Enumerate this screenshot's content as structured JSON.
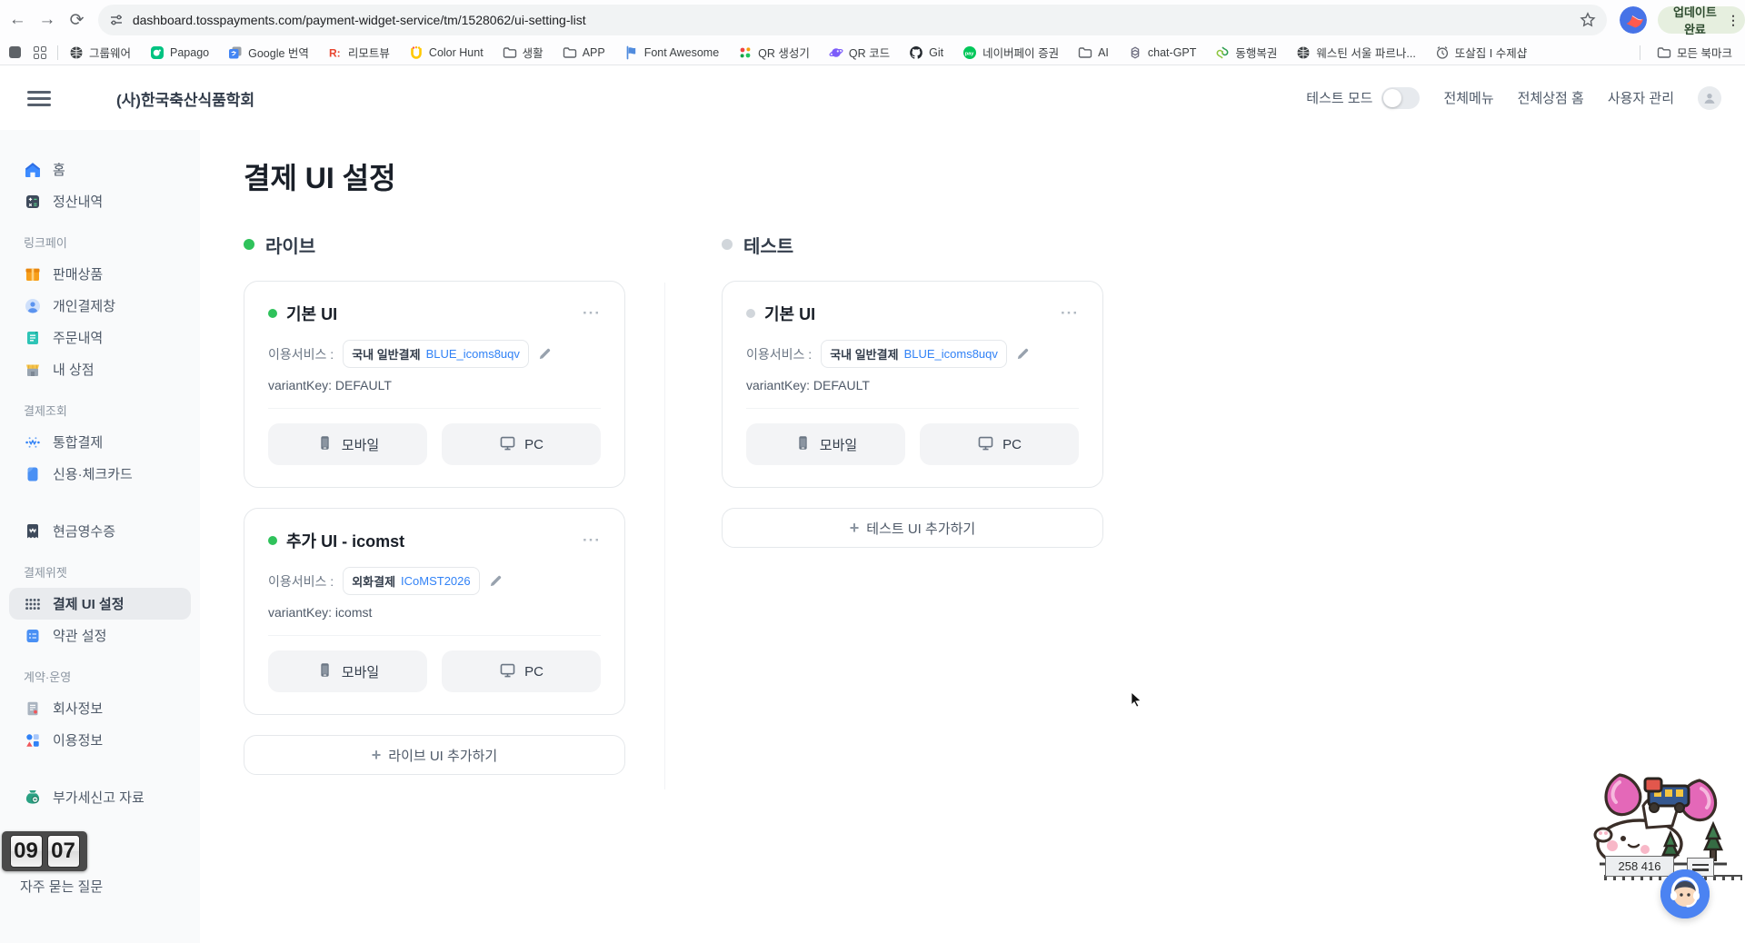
{
  "colors": {
    "accent": "#3182f6",
    "live_dot": "#2fc25b",
    "test_dot": "#d1d6db"
  },
  "browser": {
    "url": "dashboard.tosspayments.com/payment-widget-service/tm/1528062/ui-setting-list",
    "update_label": "업데이트 완료",
    "all_bookmarks_label": "모든 북마크",
    "bookmarks": [
      {
        "label": "그룹웨어",
        "icon": "globe-dark"
      },
      {
        "label": "Papago",
        "icon": "papago"
      },
      {
        "label": "Google 번역",
        "icon": "gtranslate"
      },
      {
        "label": "리모트뷰",
        "icon": "remoteview"
      },
      {
        "label": "Color Hunt",
        "icon": "colorhunt"
      },
      {
        "label": "생활",
        "icon": "folder"
      },
      {
        "label": "APP",
        "icon": "folder"
      },
      {
        "label": "Font Awesome",
        "icon": "fontawesome"
      },
      {
        "label": "QR 생성기",
        "icon": "qr-generator"
      },
      {
        "label": "QR 코드",
        "icon": "qr-code"
      },
      {
        "label": "Git",
        "icon": "github"
      },
      {
        "label": "네이버페이 증권",
        "icon": "naverpay"
      },
      {
        "label": "AI",
        "icon": "folder"
      },
      {
        "label": "chat-GPT",
        "icon": "openai"
      },
      {
        "label": "동행복권",
        "icon": "lottery"
      },
      {
        "label": "웨스틴 서울 파르나...",
        "icon": "globe-dark"
      },
      {
        "label": "또살집 I 수제샵",
        "icon": "clock"
      }
    ]
  },
  "header": {
    "title": "(사)한국축산식품학회",
    "test_mode_label": "테스트 모드",
    "links": [
      "전체메뉴",
      "전체상점 홈",
      "사용자 관리"
    ]
  },
  "sidebar": {
    "sections": [
      {
        "label": "",
        "items": [
          {
            "label": "홈",
            "icon": "home"
          },
          {
            "label": "정산내역",
            "icon": "calculator"
          }
        ]
      },
      {
        "label": "링크페이",
        "items": [
          {
            "label": "판매상품",
            "icon": "product-box"
          },
          {
            "label": "개인결제창",
            "icon": "person-pay"
          },
          {
            "label": "주문내역",
            "icon": "order-list"
          },
          {
            "label": "내 상점",
            "icon": "store"
          }
        ]
      },
      {
        "label": "결제조회",
        "items": [
          {
            "label": "통합결제",
            "icon": "integrated-pay"
          },
          {
            "label": "신용·체크카드",
            "icon": "credit-card"
          },
          {
            "label": "현금영수증",
            "icon": "cash-receipt",
            "gap": true
          }
        ]
      },
      {
        "label": "결제위젯",
        "items": [
          {
            "label": "결제 UI 설정",
            "icon": "grid-dots",
            "selected": true
          },
          {
            "label": "약관 설정",
            "icon": "terms"
          }
        ]
      },
      {
        "label": "계약·운영",
        "items": [
          {
            "label": "회사정보",
            "icon": "company"
          },
          {
            "label": "이용정보",
            "icon": "usage-info"
          },
          {
            "label": "부가세신고 자료",
            "icon": "vat-bag",
            "gap": true
          }
        ]
      }
    ],
    "faq_label": "자주 묻는 질문"
  },
  "main": {
    "page_title": "결제 UI 설정",
    "device_buttons": {
      "mobile": "모바일",
      "pc": "PC"
    },
    "columns": [
      {
        "id": "live",
        "label": "라이브",
        "add_label": "라이브 UI 추가하기",
        "cards": [
          {
            "title": "기본 UI",
            "status": "live",
            "service_label": "이용서비스 :",
            "service_name": "국내 일반결제",
            "service_code": "BLUE_icoms8uqv",
            "variant_text": "variantKey: DEFAULT"
          },
          {
            "title": "추가 UI - icomst",
            "status": "live",
            "service_label": "이용서비스 :",
            "service_name": "외화결제",
            "service_code": "ICoMST2026",
            "variant_text": "variantKey: icomst"
          }
        ]
      },
      {
        "id": "test",
        "label": "테스트",
        "add_label": "테스트 UI 추가하기",
        "cards": [
          {
            "title": "기본 UI",
            "status": "test",
            "service_label": "이용서비스 :",
            "service_name": "국내 일반결제",
            "service_code": "BLUE_icoms8uqv",
            "variant_text": "variantKey: DEFAULT"
          }
        ]
      }
    ]
  },
  "widgets": {
    "clock": {
      "hours": "09",
      "minutes": "07"
    },
    "counter": "258 416"
  }
}
